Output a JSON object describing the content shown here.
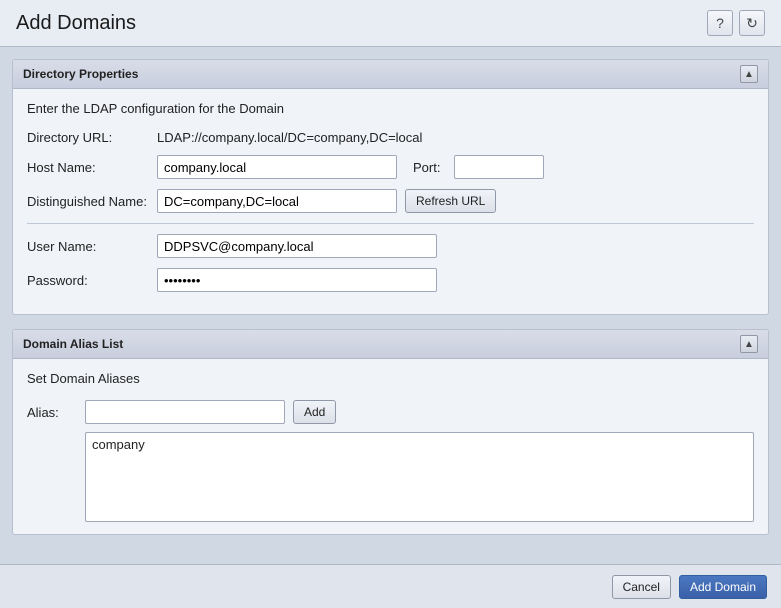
{
  "title": "Add Domains",
  "header_icons": {
    "help_label": "?",
    "refresh_label": "↻"
  },
  "directory_properties": {
    "panel_title": "Directory Properties",
    "description": "Enter the LDAP configuration for the Domain",
    "collapse_icon": "▲",
    "fields": {
      "directory_url_label": "Directory URL:",
      "directory_url_value": "LDAP://company.local/DC=company,DC=local",
      "host_name_label": "Host Name:",
      "host_name_value": "company.local",
      "port_label": "Port:",
      "port_value": "",
      "port_placeholder": "",
      "distinguished_name_label": "Distinguished Name:",
      "distinguished_name_value": "DC=company,DC=local",
      "refresh_url_label": "Refresh URL",
      "user_name_label": "User Name:",
      "user_name_value": "DDPSVC@company.local",
      "password_label": "Password:",
      "password_value": "••••••••"
    }
  },
  "domain_alias_list": {
    "panel_title": "Domain Alias List",
    "description": "Set Domain Aliases",
    "collapse_icon": "▲",
    "alias_label": "Alias:",
    "alias_placeholder": "",
    "add_button_label": "Add",
    "aliases": [
      "company"
    ]
  },
  "footer": {
    "cancel_label": "Cancel",
    "add_domain_label": "Add Domain"
  }
}
